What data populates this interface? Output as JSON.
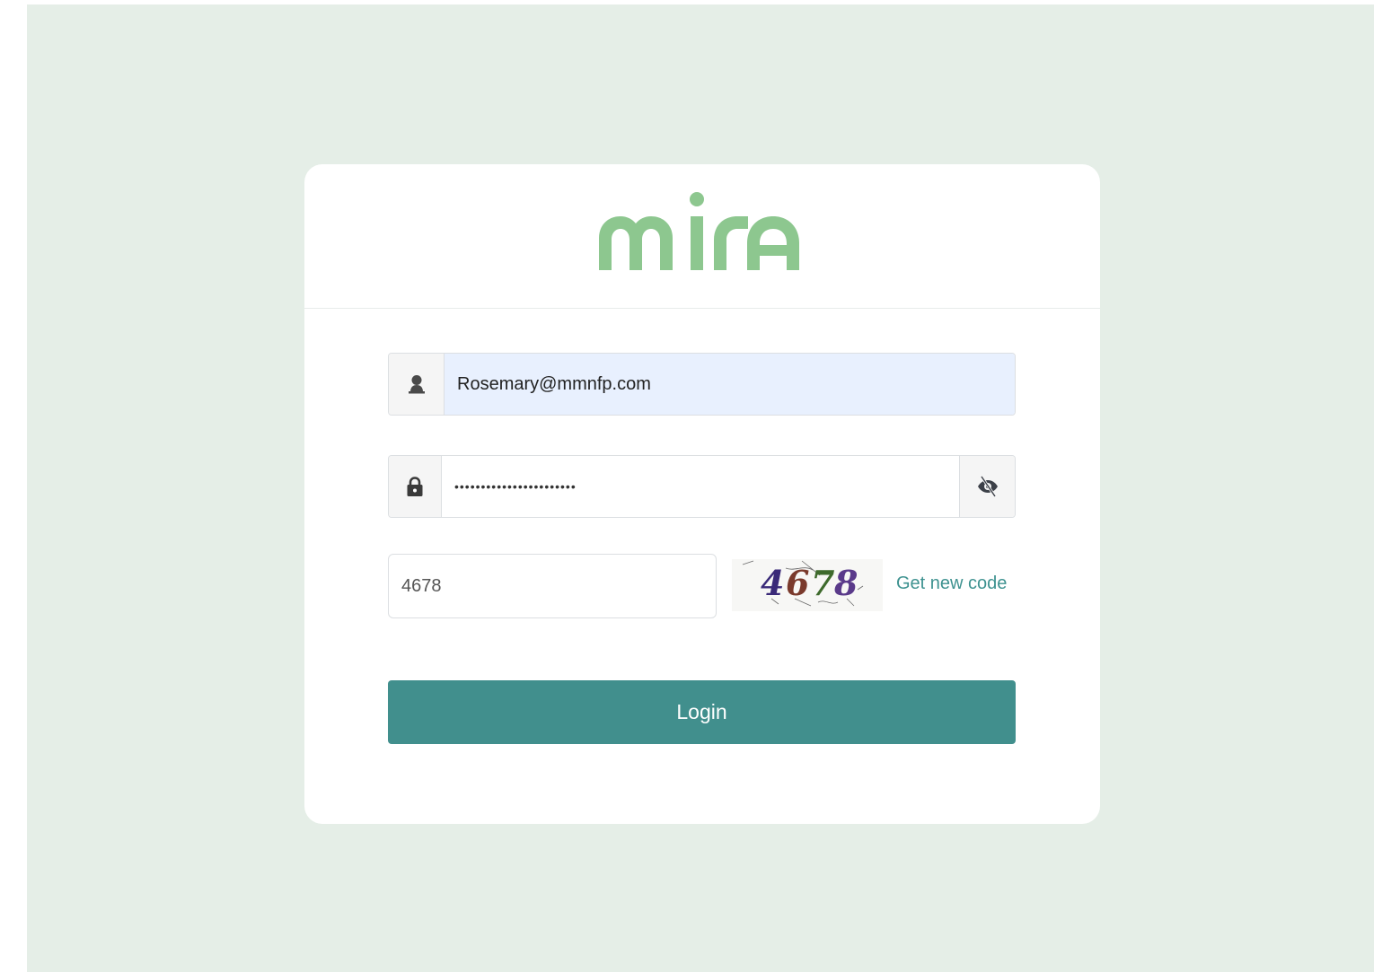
{
  "brand": {
    "logo_text": "mira",
    "logo_color": "#8dc78f"
  },
  "login_form": {
    "username": {
      "icon": "user-icon",
      "value": "Rosemary@mmnfp.com"
    },
    "password": {
      "icon": "lock-icon",
      "masked_value": "•••••••••••••••••••••••",
      "toggle_icon": "eye-slash-icon"
    },
    "captcha": {
      "input_value": "4678",
      "image_code": "4678",
      "refresh_label": "Get new code"
    },
    "submit_label": "Login"
  },
  "colors": {
    "page_background": "#e5eee7",
    "primary": "#418f8d",
    "link": "#3e9290",
    "autofill_background": "#e8f0fe"
  }
}
